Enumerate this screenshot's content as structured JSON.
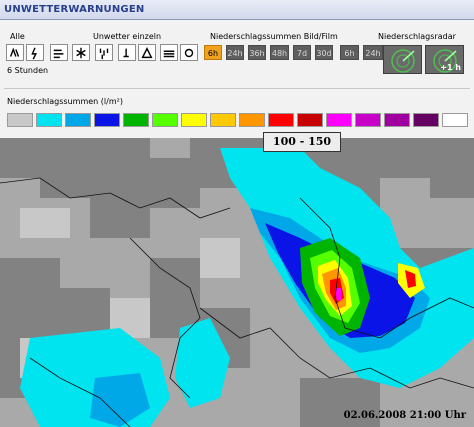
{
  "window": {
    "title": "UNWETTERWARNUNGEN"
  },
  "sections": {
    "all_label": "Alle",
    "single_label": "Unwetter einzeln",
    "precip_label": "Niederschlagssummen Bild/Film",
    "radar_label": "Niederschlagsradar"
  },
  "warning_icons": [
    {
      "name": "all-warnings-icon"
    },
    {
      "name": "thunderstorm-icon"
    },
    {
      "name": "wind-icon"
    },
    {
      "name": "snow-icon"
    },
    {
      "name": "heavy-rain-icon"
    },
    {
      "name": "black-ice-icon"
    },
    {
      "name": "frost-icon"
    },
    {
      "name": "fog-icon"
    },
    {
      "name": "heat-icon"
    }
  ],
  "time_buttons": [
    {
      "label": "6h",
      "active": true
    },
    {
      "label": "24h",
      "active": false
    },
    {
      "label": "36h",
      "active": false
    },
    {
      "label": "48h",
      "active": false
    },
    {
      "label": "7d",
      "active": false
    },
    {
      "label": "30d",
      "active": false
    },
    {
      "label": "6h",
      "active": false
    },
    {
      "label": "24h",
      "active": false
    }
  ],
  "radar_buttons": [
    {
      "name": "radar-now-icon",
      "label": ""
    },
    {
      "name": "radar-forecast-icon",
      "label": "+1 h"
    }
  ],
  "hours_label": "6 Stunden",
  "legend": {
    "title": "Niederschlagssummen (l/m²)",
    "colors": [
      "#c8c8c8",
      "#00e4f0",
      "#00a8e8",
      "#0a14e6",
      "#00b400",
      "#55ff00",
      "#ffff00",
      "#ffc800",
      "#ff9600",
      "#ff0000",
      "#c80000",
      "#ff00ff",
      "#c800c8",
      "#a000a0",
      "#640064",
      "#ffffff"
    ],
    "selected_range": "100 - 150"
  },
  "map": {
    "timestamp": "02.06.2008 21:00 Uhr"
  }
}
